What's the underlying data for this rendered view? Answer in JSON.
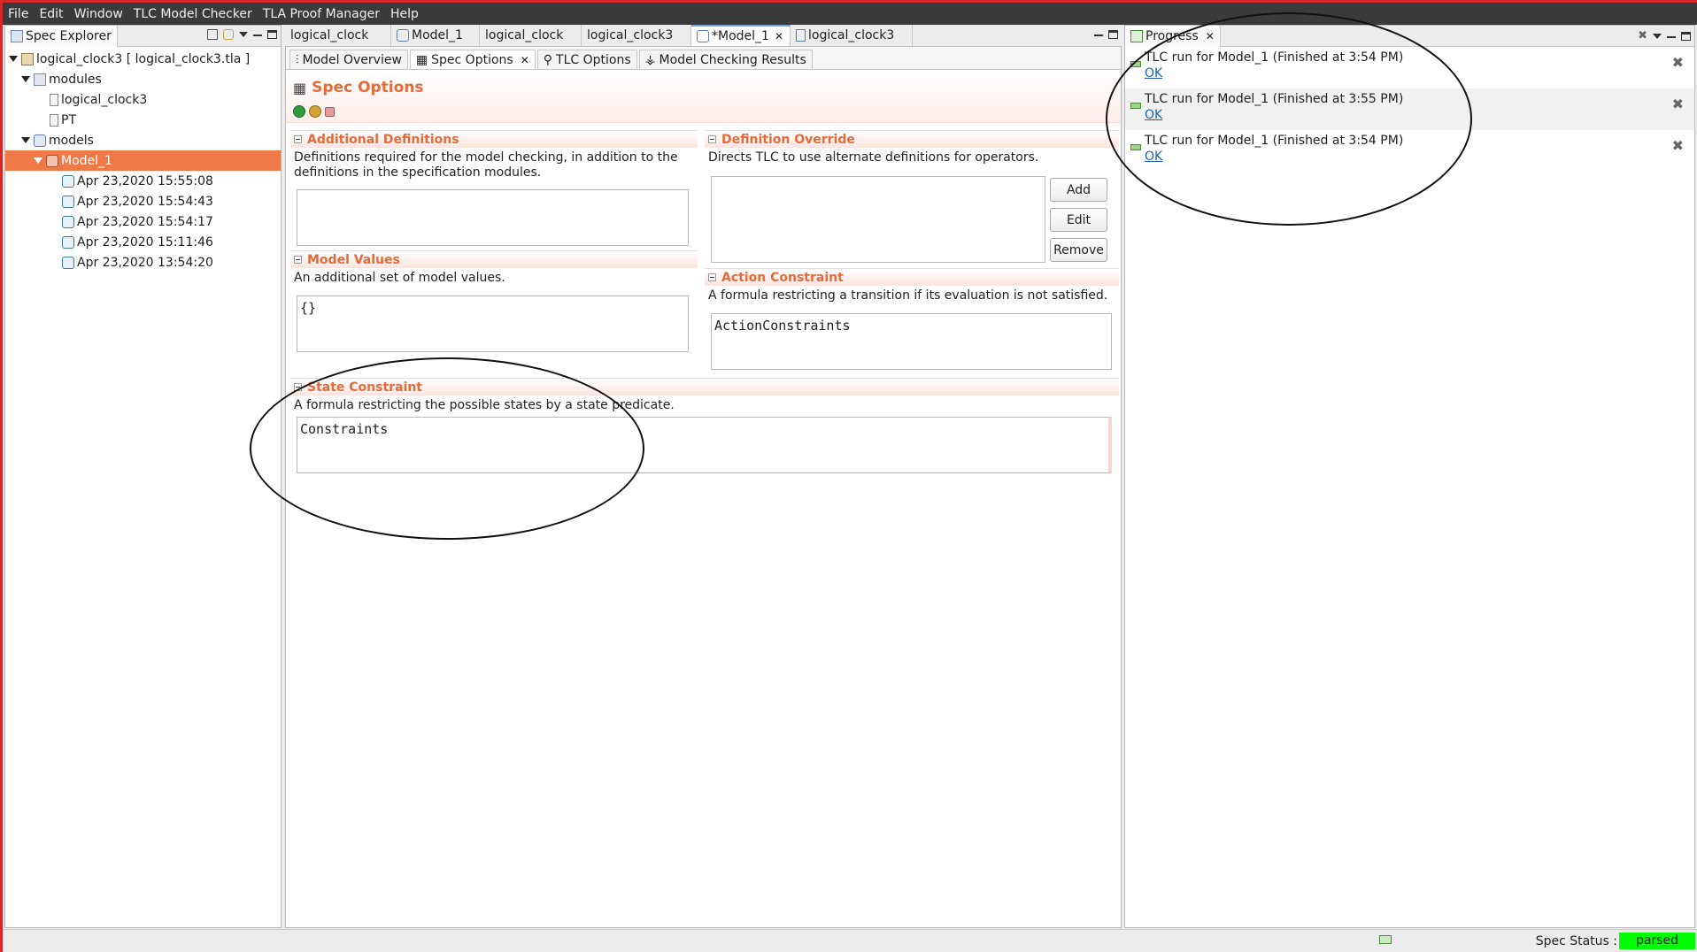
{
  "menu": [
    "File",
    "Edit",
    "Window",
    "TLC Model Checker",
    "TLA Proof Manager",
    "Help"
  ],
  "spec_explorer": {
    "title": "Spec Explorer",
    "root": "logical_clock3 [ logical_clock3.tla ]",
    "modules_label": "modules",
    "modules": [
      "logical_clock3",
      "PT"
    ],
    "models_label": "models",
    "model": "Model_1",
    "snapshots": [
      "Apr 23,2020 15:55:08",
      "Apr 23,2020 15:54:43",
      "Apr 23,2020 15:54:17",
      "Apr 23,2020 15:11:46",
      "Apr 23,2020 13:54:20"
    ]
  },
  "editor_tabs": [
    "logical_clock",
    "Model_1",
    "logical_clock",
    "logical_clock3",
    "*Model_1",
    "logical_clock3"
  ],
  "sub_tabs": [
    "Model Overview",
    "Spec Options",
    "TLC Options",
    "Model Checking Results"
  ],
  "page_title": "Spec Options",
  "sections": {
    "additional_definitions": {
      "title": "Additional Definitions",
      "desc": "Definitions required for the model checking, in addition to the definitions in the specification modules.",
      "value": ""
    },
    "model_values": {
      "title": "Model Values",
      "desc": "An additional set of model values.",
      "value": "{}"
    },
    "definition_override": {
      "title": "Definition Override",
      "desc": "Directs TLC to use alternate definitions for operators.",
      "buttons": {
        "add": "Add",
        "edit": "Edit",
        "remove": "Remove"
      }
    },
    "action_constraint": {
      "title": "Action Constraint",
      "desc": "A formula restricting a transition if its evaluation is not satisfied.",
      "value": "ActionConstraints"
    },
    "state_constraint": {
      "title": "State Constraint",
      "desc": "A formula restricting the possible states by a state predicate.",
      "value": "Constraints"
    }
  },
  "progress": {
    "title": "Progress",
    "items": [
      {
        "text": "TLC run for Model_1 (Finished at 3:54 PM)",
        "link": "OK"
      },
      {
        "text": "TLC run for Model_1 (Finished at 3:55 PM)",
        "link": "OK"
      },
      {
        "text": "TLC run for Model_1 (Finished at 3:54 PM)",
        "link": "OK"
      }
    ]
  },
  "status": {
    "label": "Spec Status :",
    "value": "parsed",
    "value_color": "#00ff00"
  }
}
